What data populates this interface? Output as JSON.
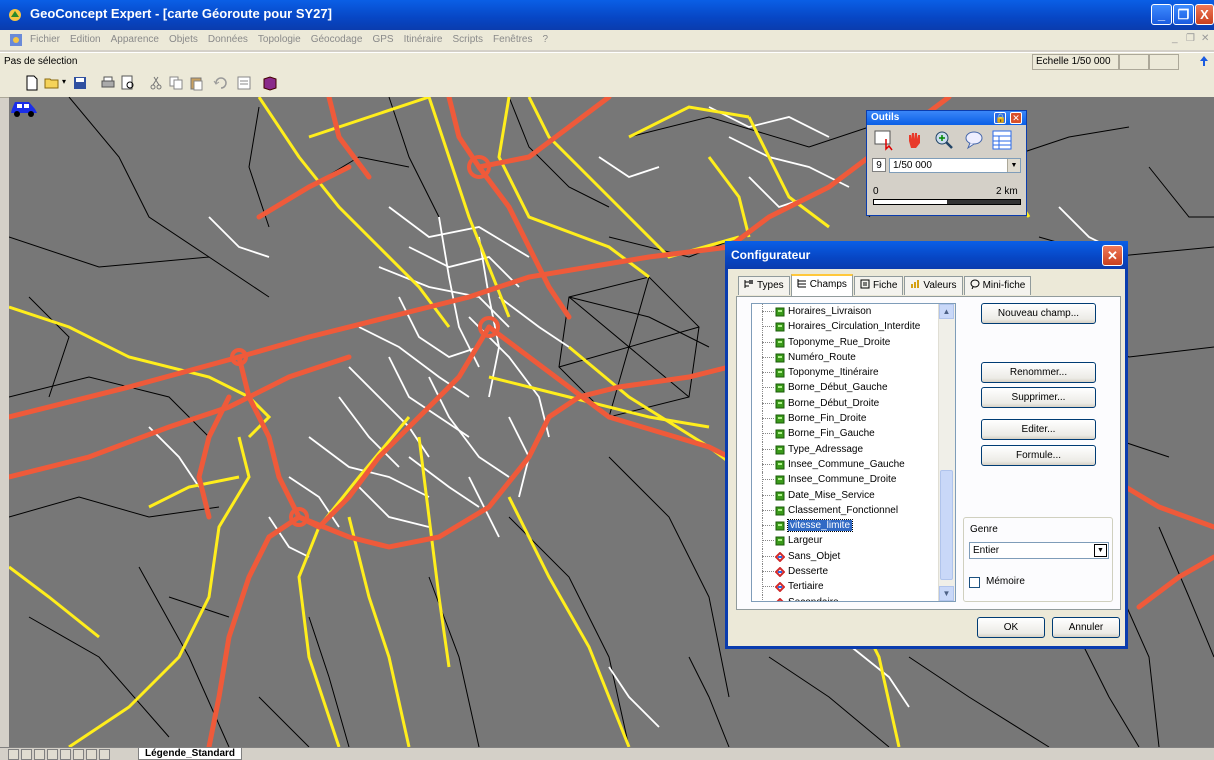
{
  "window": {
    "title": "GeoConcept Expert - [carte Géoroute pour SY27]",
    "minimize": "_",
    "restore": "❐",
    "close": "X"
  },
  "menu": {
    "items": [
      "Fichier",
      "Edition",
      "Apparence",
      "Objets",
      "Données",
      "Topologie",
      "Géocodage",
      "GPS",
      "Itinéraire",
      "Scripts",
      "Fenêtres",
      "?"
    ]
  },
  "status": {
    "selection": "Pas de sélection",
    "scale": "Echelle 1/50 000"
  },
  "outils": {
    "title": "Outils",
    "level": "9",
    "zoom_value": "1/50 000",
    "scalebar_start": "0",
    "scalebar_end": "2 km"
  },
  "configurateur": {
    "title": "Configurateur",
    "tabs": [
      "Types",
      "Champs",
      "Fiche",
      "Valeurs",
      "Mini-fiche"
    ],
    "active_tab": "Champs",
    "fields": [
      {
        "label": "Horaires_Livraison",
        "type": "field"
      },
      {
        "label": "Horaires_Circulation_Interdite",
        "type": "field"
      },
      {
        "label": "Toponyme_Rue_Droite",
        "type": "field"
      },
      {
        "label": "Numéro_Route",
        "type": "field"
      },
      {
        "label": "Toponyme_Itinéraire",
        "type": "field"
      },
      {
        "label": "Borne_Début_Gauche",
        "type": "field"
      },
      {
        "label": "Borne_Début_Droite",
        "type": "field"
      },
      {
        "label": "Borne_Fin_Droite",
        "type": "field"
      },
      {
        "label": "Borne_Fin_Gauche",
        "type": "field"
      },
      {
        "label": "Type_Adressage",
        "type": "field"
      },
      {
        "label": "Insee_Commune_Gauche",
        "type": "field"
      },
      {
        "label": "Insee_Commune_Droite",
        "type": "field"
      },
      {
        "label": "Date_Mise_Service",
        "type": "field"
      },
      {
        "label": "Classement_Fonctionnel",
        "type": "field"
      },
      {
        "label": "vitesse_limite",
        "type": "field",
        "selected": true
      },
      {
        "label": "Largeur",
        "type": "field"
      },
      {
        "label": "Sans_Objet",
        "type": "subtype"
      },
      {
        "label": "Desserte",
        "type": "subtype"
      },
      {
        "label": "Tertiaire",
        "type": "subtype"
      },
      {
        "label": "Secondaire",
        "type": "subtype"
      }
    ],
    "buttons": {
      "new_field": "Nouveau champ...",
      "rename": "Renommer...",
      "delete": "Supprimer...",
      "edit": "Editer...",
      "formula": "Formule..."
    },
    "genre": {
      "label": "Genre",
      "value": "Entier",
      "memory_label": "Mémoire",
      "memory_checked": false
    },
    "ok": "OK",
    "cancel": "Annuler"
  },
  "bottom": {
    "legend_tab": "Légende_Standard"
  },
  "colors": {
    "map_background": "#777777",
    "road_major": "#ef5a3a",
    "road_secondary": "#ffee1c",
    "road_minor": "#ffffff",
    "road_local": "#000000",
    "titlebar": "#0a5fe6",
    "selection": "#316ac5"
  }
}
